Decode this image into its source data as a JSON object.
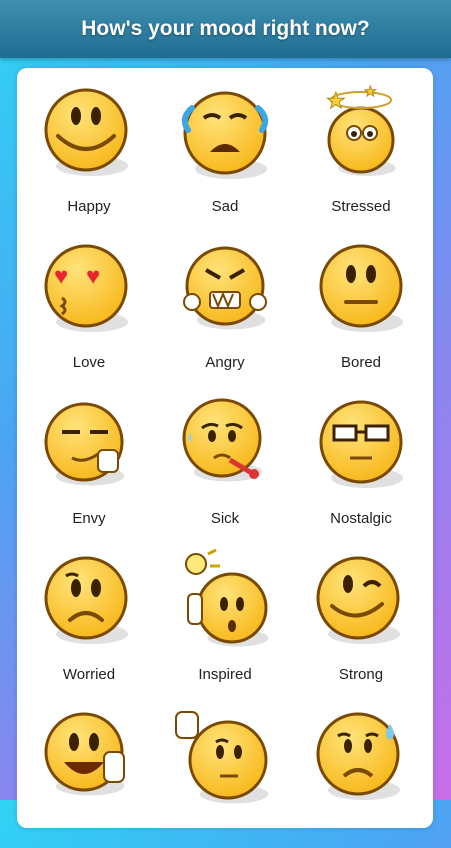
{
  "header": {
    "title": "How's your mood right now?"
  },
  "colors": {
    "face": "#f7b617",
    "face_light": "#ffe37a",
    "outline": "#7a4a05"
  },
  "moods": [
    {
      "label": "Happy",
      "icon": "happy-face-icon"
    },
    {
      "label": "Sad",
      "icon": "crying-face-icon"
    },
    {
      "label": "Stressed",
      "icon": "dizzy-face-icon"
    },
    {
      "label": "Love",
      "icon": "heart-eyes-face-icon"
    },
    {
      "label": "Angry",
      "icon": "angry-face-icon"
    },
    {
      "label": "Bored",
      "icon": "neutral-face-icon"
    },
    {
      "label": "Envy",
      "icon": "smirk-face-icon"
    },
    {
      "label": "Sick",
      "icon": "sick-face-icon"
    },
    {
      "label": "Nostalgic",
      "icon": "glasses-face-icon"
    },
    {
      "label": "Worried",
      "icon": "worried-face-icon"
    },
    {
      "label": "Inspired",
      "icon": "lightbulb-face-icon"
    },
    {
      "label": "Strong",
      "icon": "wink-face-icon"
    },
    {
      "label": "",
      "icon": "thumbs-up-face-icon"
    },
    {
      "label": "",
      "icon": "thinking-face-icon"
    },
    {
      "label": "",
      "icon": "sweat-face-icon"
    }
  ]
}
